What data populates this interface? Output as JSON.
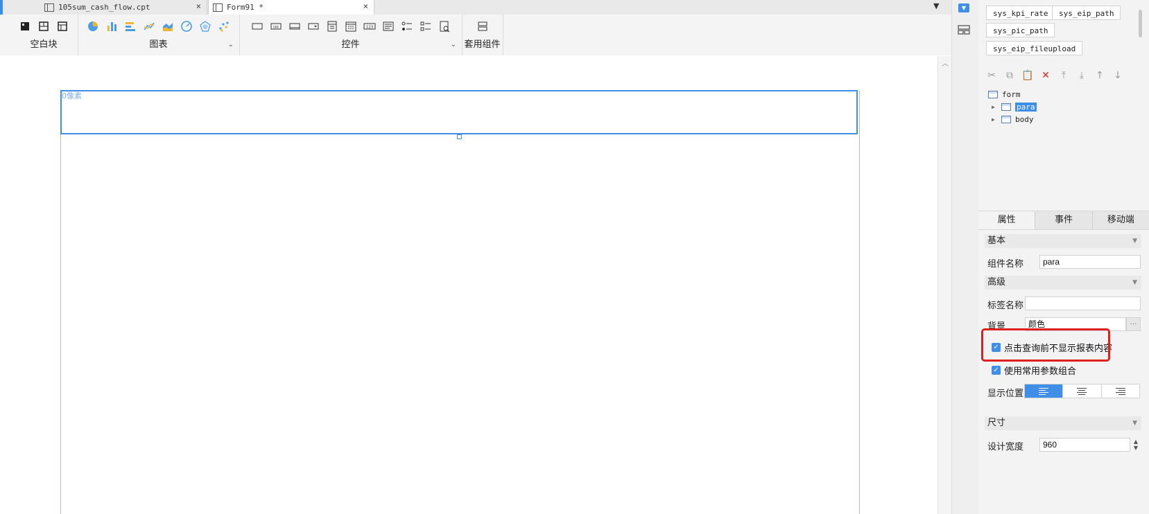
{
  "tabs": [
    {
      "label": "105sum_cash_flow.cpt",
      "close": "×"
    },
    {
      "label": "Form91 *",
      "close": "×"
    }
  ],
  "toolbar": {
    "groups": [
      {
        "label": "空白块"
      },
      {
        "label": "图表",
        "caret": "⌄"
      },
      {
        "label": "控件",
        "caret": "⌄"
      },
      {
        "label": "套用组件"
      }
    ]
  },
  "canvas": {
    "para_label": "0像素"
  },
  "right_panel": {
    "params": [
      "sys_kpi_rate",
      "sys_eip_path",
      "sys_pic_path",
      "sys_eip_fileupload"
    ],
    "tree": {
      "root": "form",
      "children": [
        "para",
        "body"
      ]
    },
    "tabs": [
      "属性",
      "事件",
      "移动端"
    ],
    "sections": {
      "basic": "基本",
      "advanced": "高级",
      "size": "尺寸"
    },
    "fields": {
      "component_name_label": "组件名称",
      "component_name_value": "para",
      "tag_name_label": "标签名称",
      "tag_name_value": "",
      "background_label": "背景",
      "background_value": "颜色",
      "background_more": "···",
      "checkbox1_label": "点击查询前不显示报表内容",
      "checkbox2_label": "使用常用参数组合",
      "position_label": "显示位置",
      "design_width_label": "设计宽度",
      "design_width_value": "960"
    },
    "spinner": {
      "up": "▲",
      "down": "▼"
    }
  },
  "colors": {
    "accent": "#3f8fe6",
    "highlight": "#e02020"
  }
}
